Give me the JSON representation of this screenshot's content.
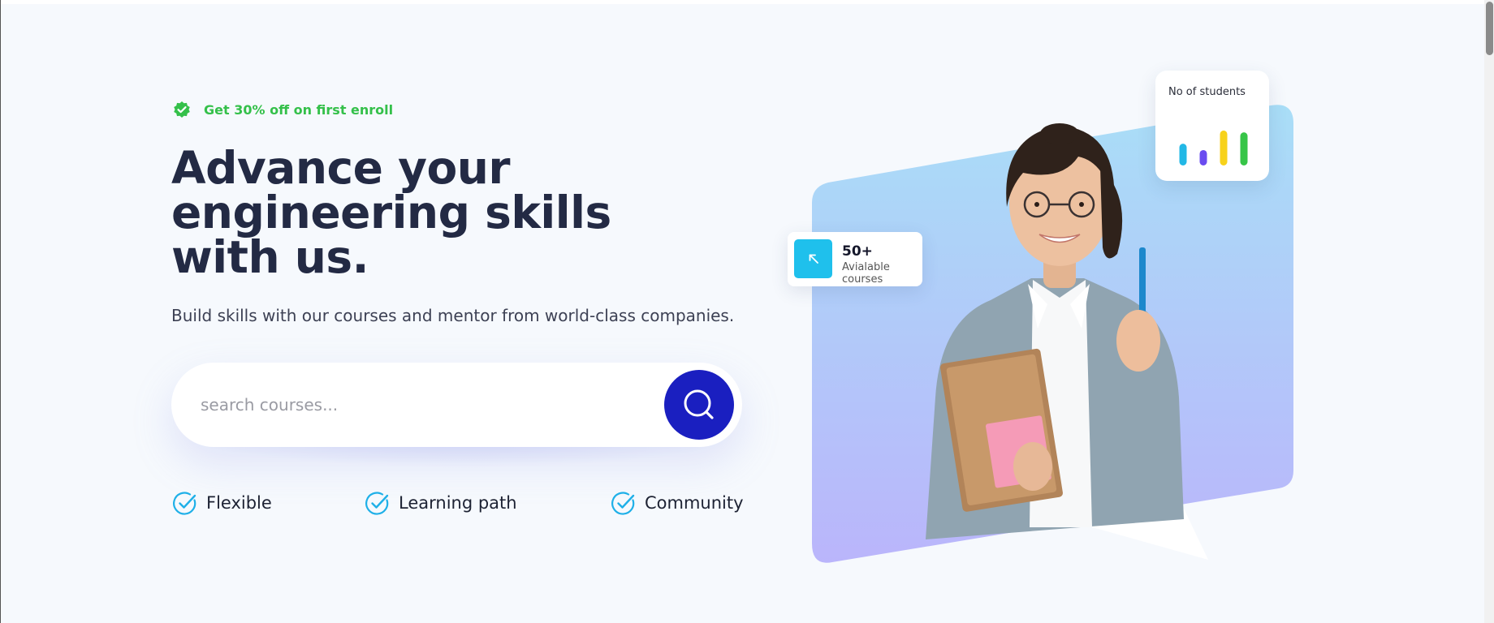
{
  "hero": {
    "badge_text": "Get 30% off on first enroll",
    "headline": "Advance your engineering skills with us.",
    "subtitle": "Build skills with our courses and mentor from world-class companies."
  },
  "search": {
    "placeholder": "search courses..."
  },
  "features": [
    {
      "label": "Flexible",
      "icon": "check-circle-icon"
    },
    {
      "label": "Learning path",
      "icon": "check-circle-icon"
    },
    {
      "label": "Community",
      "icon": "check-circle-icon"
    }
  ],
  "courses_card": {
    "count": "50+",
    "label": "Avialable courses",
    "icon": "arrow-up-left-icon"
  },
  "students_card": {
    "label": "No of students",
    "bars": [
      {
        "color": "#22b8e6",
        "value": 0.48
      },
      {
        "color": "#6a4cf0",
        "value": 0.34
      },
      {
        "color": "#f7d21c",
        "value": 0.77
      },
      {
        "color": "#37c548",
        "value": 0.73
      }
    ]
  },
  "colors": {
    "accent_green": "#34c04a",
    "primary_blue": "#1a1fc0",
    "heading": "#232a44",
    "cyan": "#1fc0ec"
  }
}
